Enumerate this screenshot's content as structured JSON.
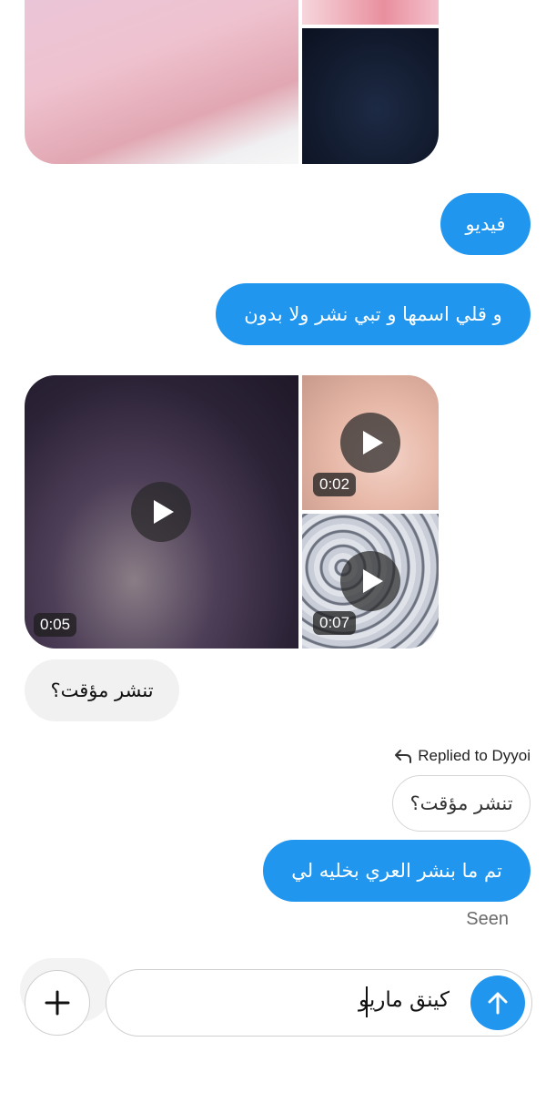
{
  "media_top": {
    "tiles": [
      "photo",
      "photo",
      "photo"
    ]
  },
  "messages": {
    "video_word": "فيديو",
    "name_request": "و قلي اسمها و تبي نشر ولا بدون",
    "temp_question": "تنشر مؤقت؟",
    "reply_label": "Replied to Dyyoi",
    "quoted_text": "تنشر مؤقت؟",
    "reply_text": "تم ما بنشر العري بخليه لي",
    "seen": "Seen"
  },
  "videos": [
    {
      "duration": "0:05"
    },
    {
      "duration": "0:02"
    },
    {
      "duration": "0:07"
    }
  ],
  "composer": {
    "text": "كينق ماريو"
  },
  "colors": {
    "sent_bubble": "#2196ee",
    "received_bubble": "#f1f1f1",
    "send_button": "#2196ee"
  },
  "icons": {
    "reply": "reply-arrow-icon",
    "play": "play-icon",
    "plus": "plus-icon",
    "send": "arrow-up-icon"
  }
}
